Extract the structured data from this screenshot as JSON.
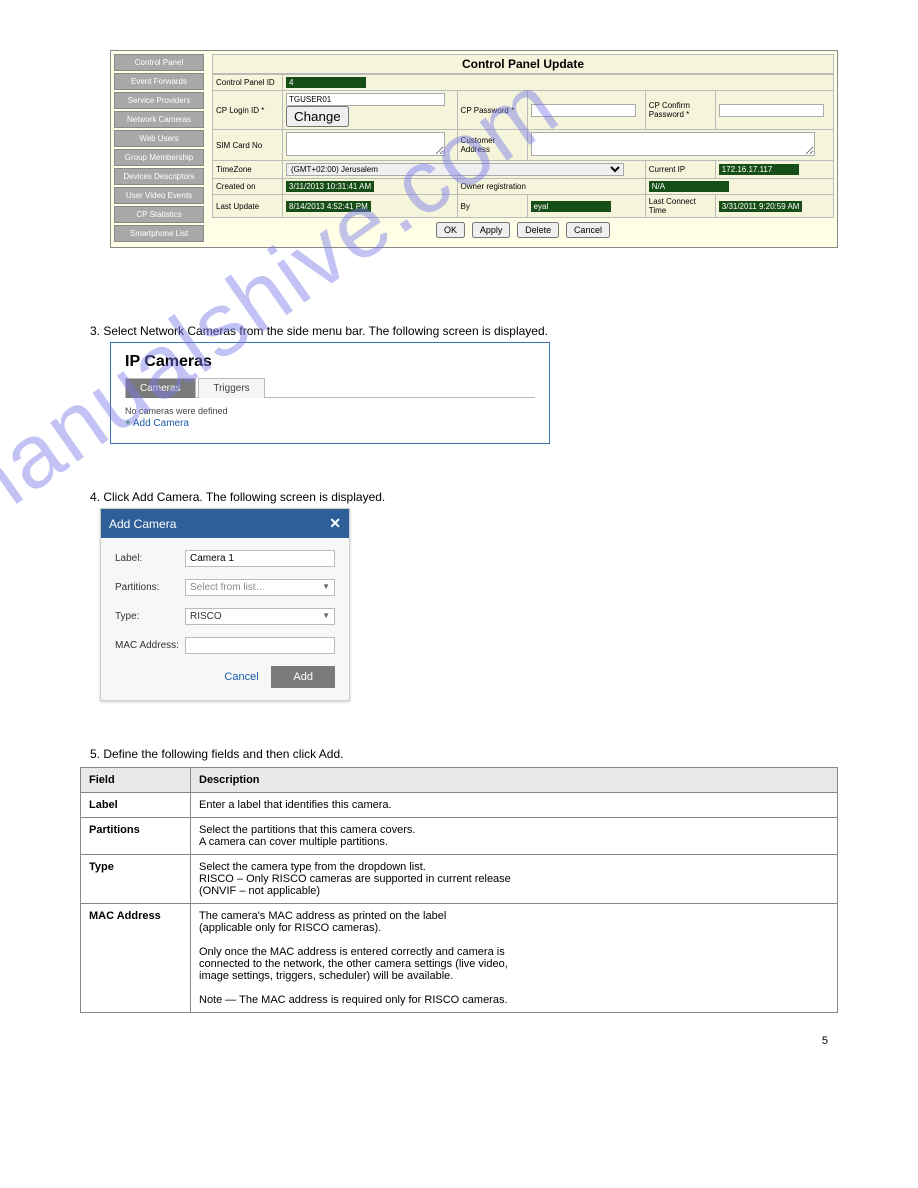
{
  "sidebar": {
    "items": [
      "Control Panel",
      "Event Forwards",
      "Service Providers",
      "Network Cameras",
      "Web Users",
      "Group Membership",
      "Devices Descriptors",
      "User Video Events",
      "CP Statistics",
      "Smartphone List"
    ]
  },
  "cp_form": {
    "title": "Control Panel Update",
    "rows": {
      "cp_id_label": "Control Panel ID",
      "cp_id_val": "4",
      "login_label": "CP Login ID *",
      "login_val": "TGUSER01",
      "change_btn": "Change",
      "pw_label": "CP Password *",
      "pw_confirm_label": "CP Confirm Password *",
      "sim_label": "SIM Card No",
      "cust_addr_label": "Customer Address",
      "tz_label": "TimeZone",
      "tz_val": "(GMT+02:00) Jerusalem",
      "curip_label": "Current IP",
      "curip_val": "172.16.17.117",
      "created_label": "Created on",
      "created_val": "3/11/2013 10:31:41 AM",
      "owner_label": "Owner registration",
      "owner_val": "N/A",
      "lastup_label": "Last Update",
      "lastup_val": "8/14/2013 4:52:41 PM",
      "by_label": "By",
      "by_val": "eyal",
      "lastconn_label": "Last Connect Time",
      "lastconn_val": "3/31/2011 9:20:59 AM"
    },
    "buttons": {
      "ok": "OK",
      "apply": "Apply",
      "delete": "Delete",
      "cancel": "Cancel"
    }
  },
  "step3": "3. Select Network Cameras from the side menu bar. The following screen is displayed.",
  "ipcam": {
    "title": "IP Cameras",
    "tab_cameras": "Cameras",
    "tab_triggers": "Triggers",
    "nocams": "No cameras were defined",
    "plus": "+",
    "addlink": "Add Camera"
  },
  "step4": "4. Click Add Camera. The following screen is displayed.",
  "dialog": {
    "title": "Add Camera",
    "label_label": "Label:",
    "label_val": "Camera 1",
    "partitions_label": "Partitions:",
    "partitions_val": "Select from list…",
    "type_label": "Type:",
    "type_val": "RISCO",
    "mac_label": "MAC Address:",
    "cancel": "Cancel",
    "add": "Add"
  },
  "step5": "5. Define the following fields and then click Add.",
  "fields_table": {
    "h1": "Field",
    "h2": "Description",
    "rows": [
      {
        "f": "Label",
        "d": "Enter a label that identifies this camera."
      },
      {
        "f": "Partitions",
        "d": "Select the partitions that this camera covers.\nA camera can cover multiple partitions."
      },
      {
        "f": "Type",
        "d": "Select the camera type from the dropdown list.\nRISCO – Only RISCO cameras are supported in current release\n(ONVIF – not applicable)"
      },
      {
        "f": "MAC Address",
        "d": "The camera's MAC address as printed on the label\n(applicable only for RISCO cameras).\n\nOnly once the MAC address is entered correctly and camera is\nconnected to the network, the other camera settings (live video,\nimage settings, triggers, scheduler) will be available.\n\nNote — The MAC address is required only for RISCO cameras."
      }
    ]
  },
  "pagenum": "5",
  "watermark_text": "manualshive.com"
}
